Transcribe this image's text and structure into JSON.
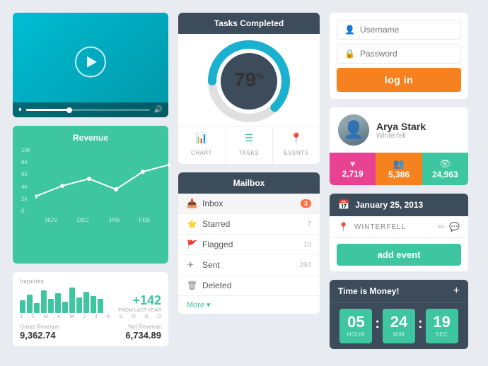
{
  "video": {
    "play_label": "▶",
    "pause_label": "⏸",
    "volume_label": "🔊",
    "progress": 35
  },
  "revenue": {
    "title": "Revenue",
    "y_labels": [
      "10k",
      "8k",
      "6k",
      "4k",
      "2k",
      "0"
    ],
    "x_labels": [
      "NOV",
      "DEC",
      "JAN",
      "FEB"
    ],
    "inquiries_label": "Inquiries",
    "bar_labels": "J F M A M J J A S O N D",
    "stat_number": "+142",
    "stat_sub": "FROM LAST YEAR",
    "gross_label": "Gross Revenue",
    "gross_value": "9,362.74",
    "net_label": "Net Revenue",
    "net_value": "6,734.89"
  },
  "tasks": {
    "header": "Tasks Completed",
    "percent": "79",
    "percent_sup": "%",
    "tabs": [
      {
        "icon": "📊",
        "label": "CHART"
      },
      {
        "icon": "☰",
        "label": "TASKS"
      },
      {
        "icon": "📍",
        "label": "EVENTS"
      }
    ]
  },
  "mailbox": {
    "header": "Mailbox",
    "items": [
      {
        "icon": "📥",
        "label": "Inbox",
        "count": "3",
        "type": "badge",
        "active": true
      },
      {
        "icon": "⭐",
        "label": "Starred",
        "count": "7",
        "type": "count"
      },
      {
        "icon": "🚩",
        "label": "Flagged",
        "count": "10",
        "type": "count"
      },
      {
        "icon": "✈",
        "label": "Sent",
        "count": "294",
        "type": "count"
      },
      {
        "icon": "🗑",
        "label": "Deleted",
        "count": "",
        "type": "count"
      }
    ],
    "more_label": "More ▾"
  },
  "login": {
    "username_placeholder": "Username",
    "password_placeholder": "Password",
    "button_label": "log in"
  },
  "profile": {
    "name": "Arya Stark",
    "location": "Winterfell",
    "stats": [
      {
        "icon": "♥",
        "value": "2,719"
      },
      {
        "icon": "👥",
        "value": "5,386"
      },
      {
        "icon": "👁",
        "value": "24,963"
      }
    ]
  },
  "event": {
    "date": "January 25, 2013",
    "location": "WINTERFELL",
    "button_label": "add event"
  },
  "timer": {
    "title": "Time is Money!",
    "plus": "+",
    "hours": "05",
    "minutes": "24",
    "seconds": "19",
    "hour_label": "HOUR",
    "min_label": "MIN",
    "sec_label": "SEC"
  }
}
